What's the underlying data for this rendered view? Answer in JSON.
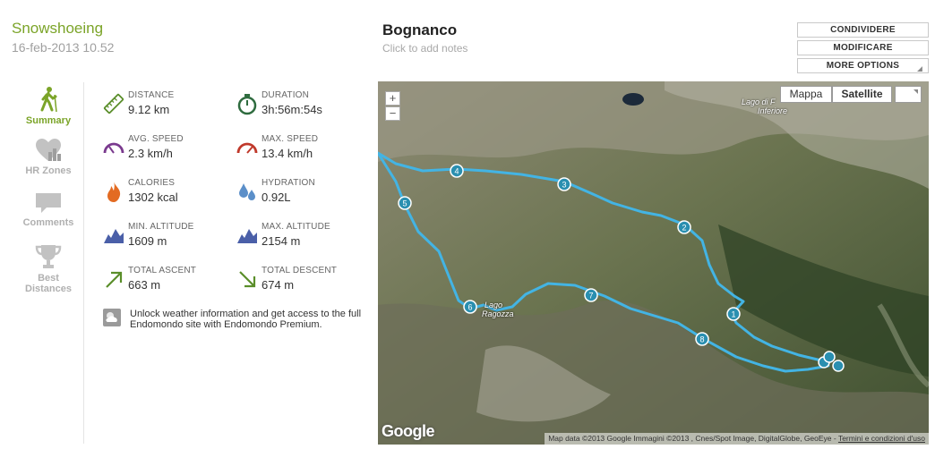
{
  "workout": {
    "sport": "Snowshoeing",
    "datetime": "16-feb-2013 10.52"
  },
  "map_header": {
    "title": "Bognanco",
    "notes_placeholder": "Click to add notes"
  },
  "actions": {
    "share": "CONDIVIDERE",
    "edit": "MODIFICARE",
    "more": "MORE OPTIONS"
  },
  "nav": {
    "items": [
      {
        "id": "summary",
        "label": "Summary",
        "icon": "hiker-icon",
        "active": true
      },
      {
        "id": "hr",
        "label": "HR Zones",
        "icon": "heart-chart-icon"
      },
      {
        "id": "comments",
        "label": "Comments",
        "icon": "speech-bubble-icon"
      },
      {
        "id": "best",
        "label_1": "Best",
        "label_2": "Distances",
        "icon": "trophy-icon"
      }
    ]
  },
  "stats": {
    "distance": {
      "label": "DISTANCE",
      "value": "9.12 km",
      "icon": "ruler-icon"
    },
    "duration": {
      "label": "DURATION",
      "value": "3h:56m:54s",
      "icon": "stopwatch-icon"
    },
    "avg_speed": {
      "label": "AVG. SPEED",
      "value": "2.3 km/h",
      "icon": "speedometer-icon"
    },
    "max_speed": {
      "label": "MAX. SPEED",
      "value": "13.4 km/h",
      "icon": "speedometer-icon"
    },
    "calories": {
      "label": "CALORIES",
      "value": "1302 kcal",
      "icon": "flame-icon"
    },
    "hydration": {
      "label": "HYDRATION",
      "value": "0.92L",
      "icon": "water-drops-icon"
    },
    "min_altitude": {
      "label": "MIN. ALTITUDE",
      "value": "1609 m",
      "icon": "mountain-icon"
    },
    "max_altitude": {
      "label": "MAX. ALTITUDE",
      "value": "2154 m",
      "icon": "mountain-icon"
    },
    "total_ascent": {
      "label": "TOTAL ASCENT",
      "value": "663 m",
      "icon": "arrow-up-right-icon"
    },
    "total_descent": {
      "label": "TOTAL DESCENT",
      "value": "674 m",
      "icon": "arrow-down-right-icon"
    }
  },
  "premium": {
    "text": "Unlock weather information and get access to the full Endomondo site with Endomondo Premium.",
    "icon": "weather-icon"
  },
  "map": {
    "type_map": "Mappa",
    "type_satellite": "Satellite",
    "selected_type": "Satellite",
    "zoom_in": "+",
    "zoom_out": "−",
    "label_lake_top_1": "Lago di F",
    "label_lake_top_2": "Inferiore",
    "label_lake_mid_1": "Lago",
    "label_lake_mid_2": "Ragozza",
    "attribution": "Map data ©2013 Google Immagini ©2013 , Cnes/Spot Image, DigitalGlobe, GeoEye",
    "terms": "Termini e condizioni d'uso",
    "google_logo": "Google",
    "km_markers": [
      "1",
      "2",
      "3",
      "4",
      "5",
      "6",
      "7",
      "8"
    ],
    "route_color": "#43b4e4"
  },
  "colors": {
    "accent": "#7ba428",
    "route": "#43b4e4",
    "marker": "#2a8fb0"
  }
}
